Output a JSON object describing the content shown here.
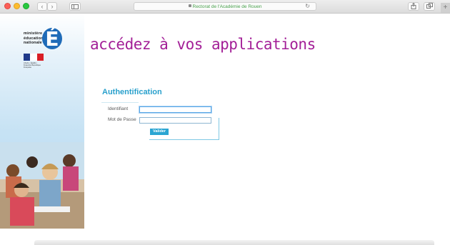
{
  "browser": {
    "address_text": "Rectorat de l'Académie de Rouen",
    "buttons": {
      "back": "‹",
      "forward": "›",
      "reload": "↻",
      "new_tab": "+"
    }
  },
  "logo": {
    "ministry_lines": [
      "ministère",
      "éducation",
      "nationale"
    ],
    "letter": "É",
    "flag_colors": [
      "#1f3a8a",
      "#ffffff",
      "#d91f26"
    ],
    "brand_color": "#1f6bb8",
    "flag_caption": "Liberté • Égalité • Fraternité République Française"
  },
  "headline": "accédez à vos applications",
  "auth": {
    "title": "Authentification",
    "identifier_label": "Identifiant",
    "identifier_value": "",
    "password_label": "Mot de Passe",
    "password_value": "",
    "submit_label": "Valider"
  },
  "colors": {
    "headline": "#a31f97",
    "auth_title": "#29a0cc",
    "button": "#2aa5d2"
  }
}
